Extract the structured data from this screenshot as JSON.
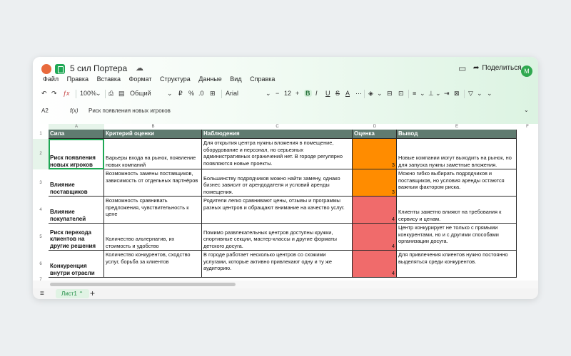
{
  "app": {
    "title": "5 сил Портера",
    "share_label": "Поделиться",
    "avatar_letter": "М"
  },
  "menu": [
    "Файл",
    "Правка",
    "Вставка",
    "Формат",
    "Структура",
    "Данные",
    "Вид",
    "Справка"
  ],
  "toolbar": {
    "undo": "↶",
    "redo": "↷",
    "format_paint": "ƒx",
    "zoom": "100%",
    "number_format": "Общий",
    "percent": "%",
    "decimals": ".0",
    "font": "Arial",
    "font_size": "12",
    "minus": "−",
    "plus": "+",
    "bold": "B",
    "italic": "I",
    "underline": "U",
    "strike": "S",
    "text_color": "A",
    "chevron": "⌄"
  },
  "formula_bar": {
    "cell_ref": "A2",
    "fx": "f(x)",
    "value": "Риск появления новых игроков"
  },
  "columns": [
    "A",
    "B",
    "C",
    "D",
    "E",
    "F"
  ],
  "rows": [
    "1",
    "2",
    "3",
    "4",
    "5",
    "6",
    "7"
  ],
  "table": {
    "headers": [
      "Сила",
      "Критерий оценки",
      "Наблюдения",
      "Оценка",
      "Вывод"
    ],
    "rows": [
      {
        "force": "Риск появления новых игроков",
        "criterion": "Барьеры входа на рынок, появление новых компаний",
        "observation": "Для открытия центра нужны вложения в помещение, оборудование и персонал, но серьезных административных ограничений нет. В городе регулярно появляются новые проекты.",
        "score": "3",
        "conclusion": "Новые компании могут выходить на рынок, но для запуска нужны заметные вложения.",
        "score_color": "#ff8c00"
      },
      {
        "force": "Влияние поставщиков",
        "criterion": "Возможность замены поставщиков, зависимость от отдельных партнёров",
        "observation": "Большинству подрядчиков можно найти замену, однако бизнес зависит от арендодателя и условий аренды помещения.",
        "score": "3",
        "conclusion": "Можно гибко выбирать подрядчиков и поставщиков, но условия аренды остаются важным фактором риска.",
        "score_color": "#ff8c00"
      },
      {
        "force": "Влияние покупателей",
        "criterion": "Возможность сравнивать предложения, чувствительность к цене",
        "observation": "Родители легко сравнивают цены, отзывы и программы разных центров и обращают внимание на качество услуг.",
        "score": "4",
        "conclusion": "Клиенты заметно влияют на требования к сервису и ценам.",
        "score_color": "#f06b6b"
      },
      {
        "force": "Риск перехода клиентов на другие решения",
        "criterion": "Количество альтернатив, их стоимость и удобство",
        "observation": "Помимо развлекательных центров доступны кружки, спортивные секции, мастер-классы и другие форматы детского досуга.",
        "score": "4",
        "conclusion": "Центр конкурирует не только с прямыми конкурентами, но и с другими способами организации досуга.",
        "score_color": "#f06b6b"
      },
      {
        "force": "Конкуренция внутри отрасли",
        "criterion": "Количество конкурентов, сходство услуг, борьба за клиентов",
        "observation": "В городе работает несколько центров со схожими услугами, которые активно привлекают одну и ту же аудиторию.",
        "score": "4",
        "conclusion": "Для привлечения клиентов нужно постоянно выделяться среди конкурентов.",
        "score_color": "#f06b6b"
      }
    ]
  },
  "sheet_tabs": {
    "active_tab": "Лист1",
    "add": "+",
    "menu": "≡"
  },
  "colors": {
    "header_bg": "#607b70",
    "accent": "#1fa855"
  }
}
